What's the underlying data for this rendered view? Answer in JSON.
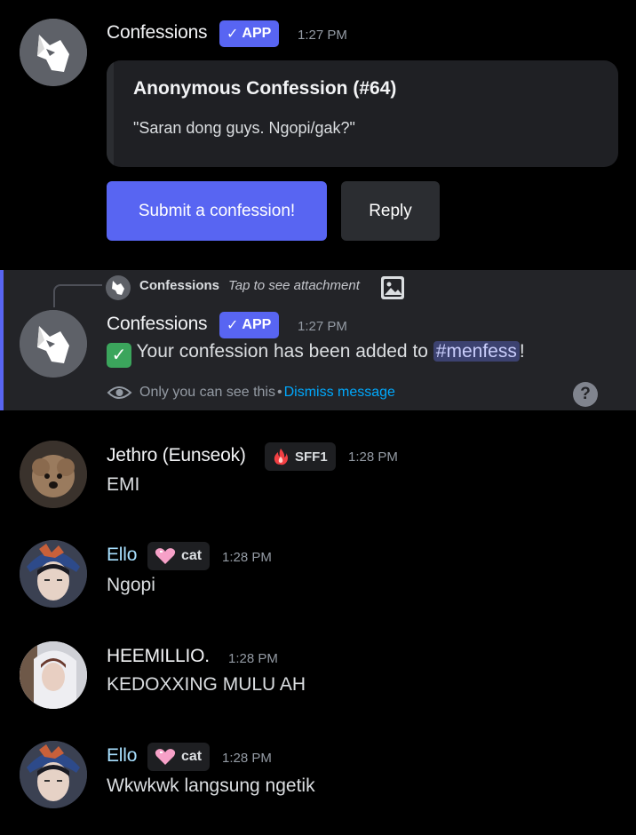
{
  "messages": [
    {
      "author": "Confessions",
      "badge": "APP",
      "time": "1:27 PM",
      "embed": {
        "title": "Anonymous Confession (#64)",
        "description": "\"Saran dong guys. Ngopi/gak?\""
      },
      "buttons": {
        "submit": "Submit a confession!",
        "reply": "Reply"
      }
    },
    {
      "reply_ref": {
        "author": "Confessions",
        "text": "Tap to see attachment"
      },
      "author": "Confessions",
      "badge": "APP",
      "time": "1:27 PM",
      "text_prefix": "Your confession has been added to",
      "channel": "#menfess",
      "text_suffix": "!",
      "notice": {
        "text": "Only you can see this",
        "separator": "•",
        "dismiss": "Dismiss message"
      }
    },
    {
      "author": "Jethro (Eunseok)",
      "tag": "SFF1",
      "time": "1:28 PM",
      "text": "EMI"
    },
    {
      "author": "Ello",
      "tag": "cat",
      "time": "1:28 PM",
      "text": "Ngopi"
    },
    {
      "author": "HEEMILLIO.",
      "time": "1:28 PM",
      "text": "KEDOXXING MULU AH"
    },
    {
      "author": "Ello",
      "tag": "cat",
      "time": "1:28 PM",
      "text": "Wkwkwk langsung ngetik"
    }
  ],
  "icons": {
    "check": "✓",
    "check_emoji": "✅",
    "help": "?",
    "attachment": "image-icon",
    "eye": "eye-icon",
    "fire": "fire-icon",
    "heart": "heart-icon"
  },
  "colors": {
    "accent": "#5865f2",
    "link": "#00a8fc",
    "background": "#000000"
  }
}
